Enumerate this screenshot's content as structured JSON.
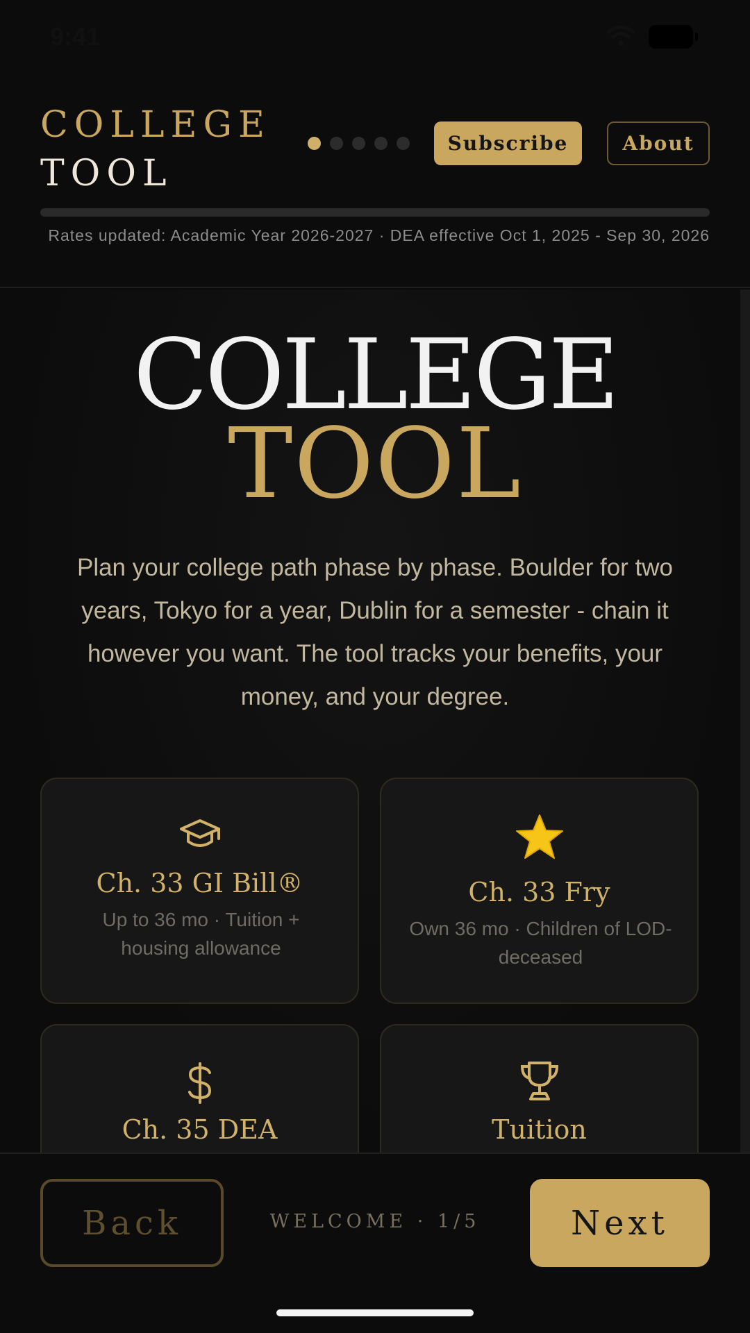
{
  "status_bar": {
    "time": "9:41"
  },
  "header": {
    "brand_line_1": "COLLEGE",
    "brand_line_2": "TOOL",
    "steps_total": 5,
    "step_current": 1,
    "subscribe_label": "Subscribe",
    "about_label": "About",
    "progress_percent": 0,
    "rates_note": "Rates updated: Academic Year 2026-2027 · DEA effective Oct 1, 2025 - Sep 30, 2026"
  },
  "hero": {
    "title_line_1": "COLLEGE",
    "title_line_2": "TOOL",
    "description": "Plan your college path phase by phase. Boulder for two years, Tokyo for a year, Dublin for a semester - chain it however you want. The tool tracks your benefits, your money, and your degree."
  },
  "cards": [
    {
      "icon": "graduation-cap-icon",
      "title": "Ch. 33 GI Bill®",
      "desc": "Up to 36 mo · Tuition + housing allowance"
    },
    {
      "icon": "star-icon",
      "title": "Ch. 33 Fry",
      "desc": "Own 36 mo · Children of LOD-deceased"
    },
    {
      "icon": "dollar-icon",
      "title": "Ch. 35 DEA",
      "desc": ""
    },
    {
      "icon": "trophy-icon",
      "title": "Tuition",
      "desc": ""
    }
  ],
  "footer": {
    "back_label": "Back",
    "step_label": "WELCOME · 1/5",
    "next_label": "Next"
  },
  "colors": {
    "accent": "#c9a75e",
    "background": "#0c0c0c",
    "card": "#171717"
  }
}
